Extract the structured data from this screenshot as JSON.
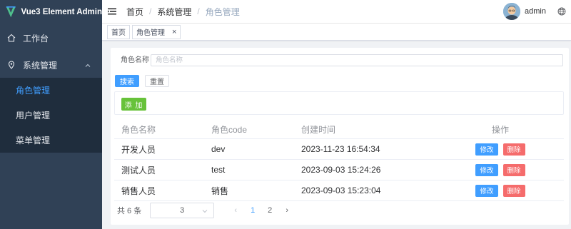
{
  "app": {
    "title": "Vue3 Element Admin"
  },
  "sidebar": {
    "items": [
      {
        "label": "工作台"
      },
      {
        "label": "系统管理"
      }
    ],
    "submenu": [
      {
        "label": "角色管理"
      },
      {
        "label": "用户管理"
      },
      {
        "label": "菜单管理"
      }
    ],
    "active_color": "#409eff"
  },
  "header": {
    "breadcrumb": [
      "首页",
      "系统管理",
      "角色管理"
    ],
    "breadcrumb_sep": "/",
    "username": "admin"
  },
  "tags": [
    {
      "label": "首页"
    },
    {
      "label": "角色管理",
      "close": "×"
    }
  ],
  "search": {
    "label": "角色名称",
    "placeholder": "角色名称",
    "value": "",
    "search_label": "搜索",
    "reset_label": "重置"
  },
  "toolbar": {
    "add_label": "添 加"
  },
  "table": {
    "columns": [
      "角色名称",
      "角色code",
      "创建时间",
      "操作"
    ],
    "rows": [
      {
        "name": "开发人员",
        "code": "dev",
        "created": "2023-11-23 16:54:34"
      },
      {
        "name": "测试人员",
        "code": "test",
        "created": "2023-09-03 15:24:26"
      },
      {
        "name": "销售人员",
        "code": "销售",
        "created": "2023-09-03 15:23:04"
      }
    ],
    "edit_label": "修改",
    "delete_label": "删除"
  },
  "pagination": {
    "total_text": "共 6 条",
    "page_size": "3",
    "pages": [
      "1",
      "2"
    ],
    "current_page": "1",
    "prev": "‹",
    "next": "›"
  }
}
